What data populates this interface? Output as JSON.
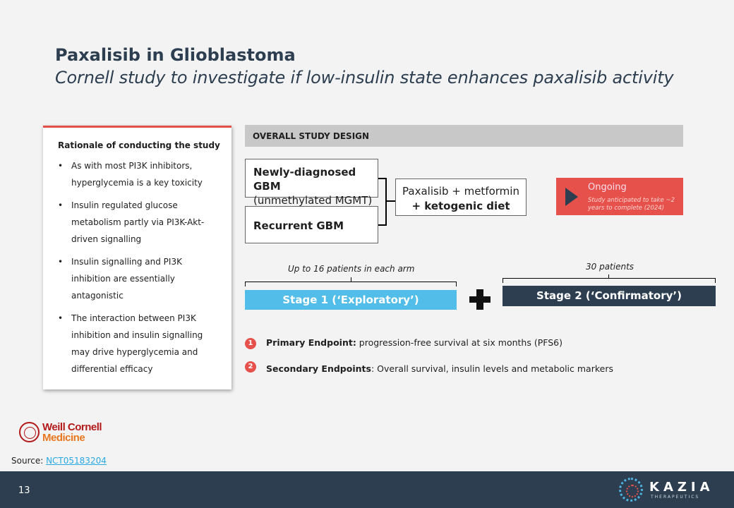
{
  "slide": {
    "title": "Paxalisib in Glioblastoma",
    "subtitle": "Cornell study to investigate if low-insulin state enhances paxalisib activity",
    "page_number": "13"
  },
  "rationale": {
    "heading": "Rationale of conducting the study",
    "bullet_symbol": "•",
    "items": [
      "As with most PI3K inhibitors, hyperglycemia is a key toxicity",
      "Insulin regulated glucose metabolism partly via PI3K-Akt-driven signalling",
      "Insulin signalling and PI3K inhibition are essentially antagonistic",
      "The interaction between PI3K inhibition and insulin signalling may drive hyperglycemia and differential efficacy"
    ]
  },
  "design": {
    "header": "OVERALL STUDY DESIGN",
    "arm1_line1": "Newly-diagnosed GBM",
    "arm1_line2": "(unmethylated MGMT)",
    "arm2": "Recurrent GBM",
    "treatment_line1": "Paxalisib + metformin",
    "treatment_line2": "+ ketogenic diet",
    "status_title": "Ongoing",
    "status_note": "Study anticipated to take ~2 years to complete (2024)",
    "stage1_caption": "Up to 16 patients in each arm",
    "stage1_label": "Stage 1 (‘Exploratory’)",
    "stage2_caption": "30 patients",
    "stage2_label": "Stage 2 (‘Confirmatory’)"
  },
  "endpoints": [
    {
      "number": "1",
      "label": "Primary Endpoint:",
      "text": " progression-free survival at six months (PFS6)"
    },
    {
      "number": "2",
      "label": "Secondary Endpoints",
      "text": ": Overall survival, insulin levels and metabolic markers"
    }
  ],
  "logos": {
    "cornell_line1": "Weill Cornell",
    "cornell_line2": "Medicine",
    "kazia_name": "KAZIA",
    "kazia_tagline": "THERAPEUTICS"
  },
  "source": {
    "label": "Source: ",
    "link_text": "NCT05183204"
  },
  "colors": {
    "accent_red": "#e6514b",
    "navy": "#2c3e50",
    "stage1_blue": "#52bde8",
    "link_blue": "#2aa8e0"
  }
}
